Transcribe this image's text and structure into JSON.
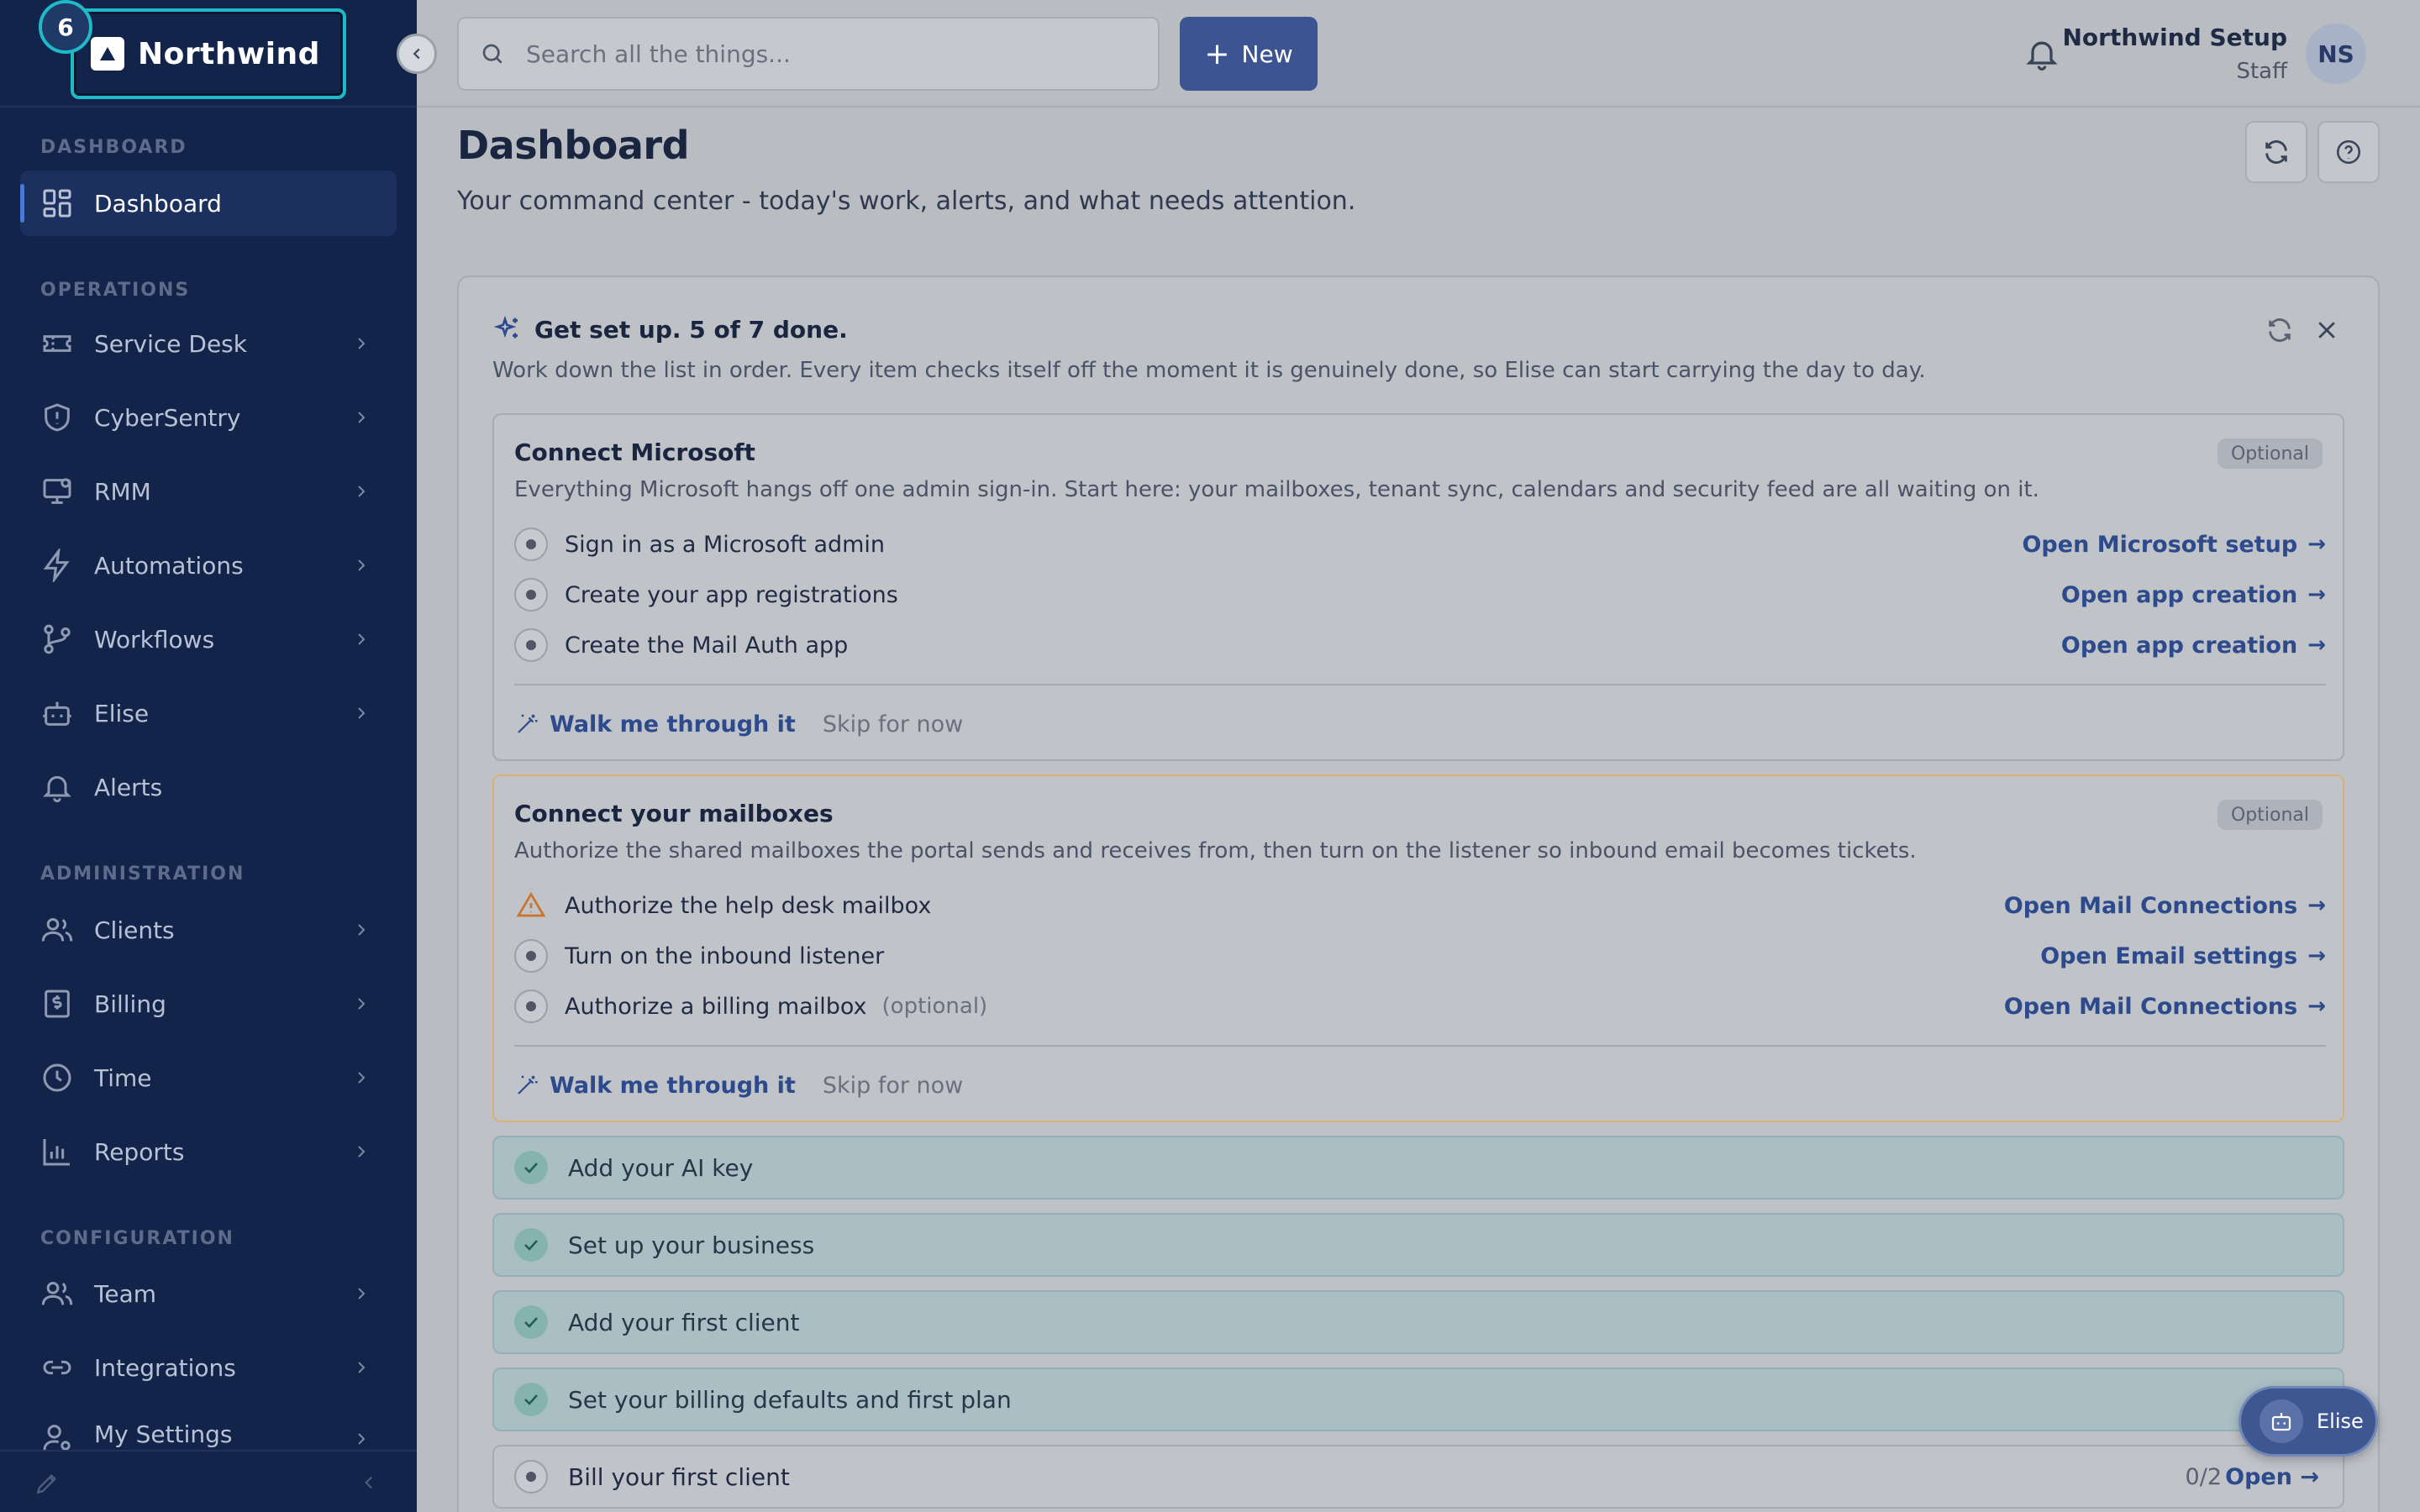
{
  "brand": {
    "name": "Northwind",
    "badge": "6"
  },
  "sidebar": {
    "sections": {
      "dashboard": "DASHBOARD",
      "operations": "OPERATIONS",
      "administration": "ADMINISTRATION",
      "configuration": "CONFIGURATION"
    },
    "items": [
      {
        "label": "Dashboard",
        "icon": "dashboard-icon",
        "active": true
      },
      {
        "label": "Service Desk",
        "icon": "ticket-icon"
      },
      {
        "label": "CyberSentry",
        "icon": "shield-icon"
      },
      {
        "label": "RMM",
        "icon": "monitor-icon"
      },
      {
        "label": "Automations",
        "icon": "bolt-icon"
      },
      {
        "label": "Workflows",
        "icon": "git-branch-icon"
      },
      {
        "label": "Elise",
        "icon": "bot-icon"
      },
      {
        "label": "Alerts",
        "icon": "bell-icon"
      },
      {
        "label": "Clients",
        "icon": "users-icon"
      },
      {
        "label": "Billing",
        "icon": "receipt-icon"
      },
      {
        "label": "Time",
        "icon": "clock-icon"
      },
      {
        "label": "Reports",
        "icon": "bar-chart-icon"
      },
      {
        "label": "Team",
        "icon": "team-icon"
      },
      {
        "label": "Integrations",
        "icon": "link-icon"
      },
      {
        "label": "My Settings",
        "icon": "user-settings-icon"
      }
    ]
  },
  "topbar": {
    "search_placeholder": "Search all the things...",
    "new_label": "New",
    "user_name": "Northwind Setup",
    "user_role": "Staff",
    "avatar_initials": "NS"
  },
  "page": {
    "title": "Dashboard",
    "subtitle": "Your command center - today's work, alerts, and what needs attention."
  },
  "setup": {
    "title": "Get set up. 5 of 7 done.",
    "description": "Work down the list in order. Every item checks itself off the moment it is genuinely done, so Elise can start carrying the day to day.",
    "optional_label": "Optional",
    "walk_label": "Walk me through it",
    "skip_label": "Skip for now",
    "steps": [
      {
        "title": "Connect Microsoft",
        "description": "Everything Microsoft hangs off one admin sign-in. Start here: your mailboxes, tenant sync, calendars and security feed are all waiting on it.",
        "tasks": [
          {
            "label": "Sign in as a Microsoft admin",
            "link": "Open Microsoft setup"
          },
          {
            "label": "Create your app registrations",
            "link": "Open app creation"
          },
          {
            "label": "Create the Mail Auth app",
            "link": "Open app creation"
          }
        ]
      },
      {
        "title": "Connect your mailboxes",
        "description": "Authorize the shared mailboxes the portal sends and receives from, then turn on the listener so inbound email becomes tickets.",
        "tasks": [
          {
            "label": "Authorize the help desk mailbox",
            "link": "Open Mail Connections",
            "warning": true
          },
          {
            "label": "Turn on the inbound listener",
            "link": "Open Email settings"
          },
          {
            "label": "Authorize a billing mailbox",
            "note": "(optional)",
            "link": "Open Mail Connections"
          }
        ]
      }
    ],
    "done": [
      "Add your AI key",
      "Set up your business",
      "Add your first client",
      "Set your billing defaults and first plan"
    ],
    "todo": {
      "label": "Bill your first client",
      "count": "0/2",
      "link": "Open"
    }
  },
  "elise_fab": {
    "label": "Elise"
  }
}
